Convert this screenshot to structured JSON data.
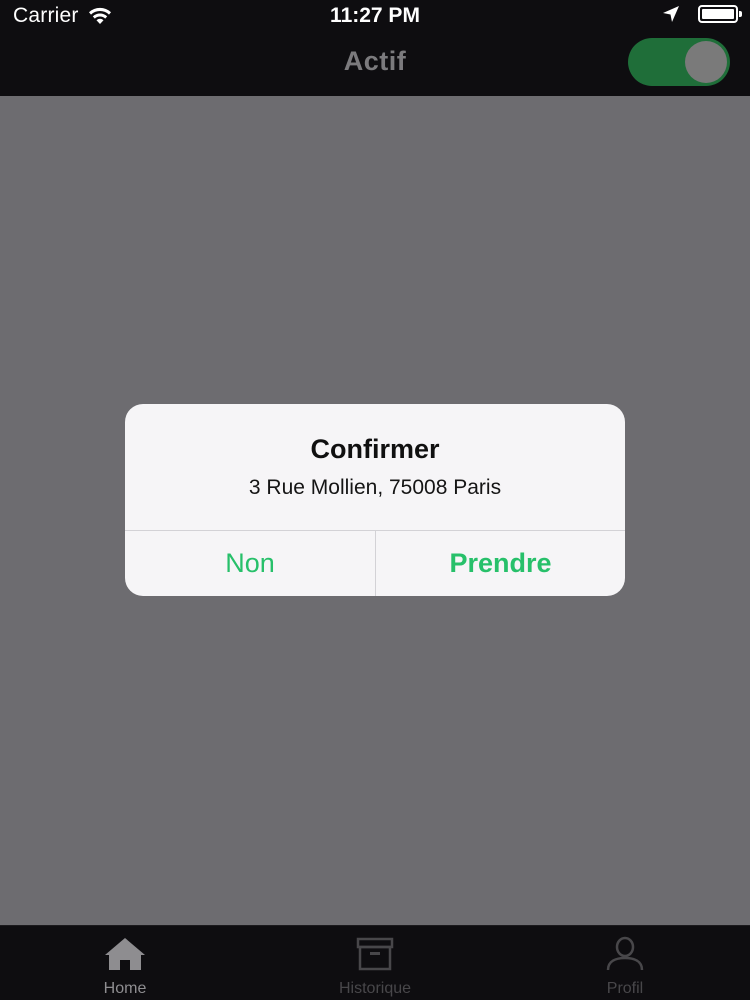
{
  "status_bar": {
    "carrier": "Carrier",
    "time": "11:27 PM",
    "icons": [
      "wifi-icon",
      "location-arrow-icon",
      "battery-icon"
    ]
  },
  "nav_bar": {
    "title": "Actif",
    "toggle_on": true,
    "toggle_color": "#1f6e39"
  },
  "alert": {
    "title": "Confirmer",
    "message": "3 Rue Mollien, 75008 Paris",
    "cancel_label": "Non",
    "confirm_label": "Prendre",
    "accent_color": "#27c06a"
  },
  "tab_bar": {
    "tabs": [
      {
        "label": "Home",
        "icon": "home-icon",
        "active": true
      },
      {
        "label": "Historique",
        "icon": "archive-box-icon",
        "active": false
      },
      {
        "label": "Profil",
        "icon": "person-icon",
        "active": false
      }
    ]
  }
}
